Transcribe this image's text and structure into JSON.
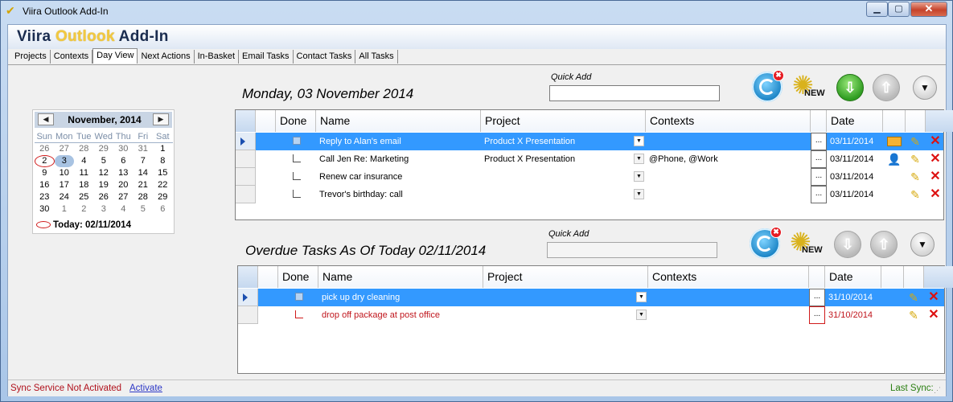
{
  "window": {
    "title": "Viira Outlook Add-In",
    "min_glyph": "▁",
    "max_glyph": "▢",
    "close_glyph": "✕"
  },
  "brand": {
    "part1": "Viira ",
    "part2": "Outlook",
    "part3": " Add-In"
  },
  "tabs": [
    {
      "label": "Projects",
      "active": false
    },
    {
      "label": "Contexts",
      "active": false
    },
    {
      "label": "Day View",
      "active": true
    },
    {
      "label": "Next Actions",
      "active": false
    },
    {
      "label": "In-Basket",
      "active": false
    },
    {
      "label": "Email Tasks",
      "active": false
    },
    {
      "label": "Contact Tasks",
      "active": false
    },
    {
      "label": "All Tasks",
      "active": false
    }
  ],
  "calendar": {
    "month_label": "November, 2014",
    "prev_glyph": "◀",
    "next_glyph": "▶",
    "weekdays": [
      "Sun",
      "Mon",
      "Tue",
      "Wed",
      "Thu",
      "Fri",
      "Sat"
    ],
    "weeks": [
      [
        "26",
        "27",
        "28",
        "29",
        "30",
        "31",
        "1"
      ],
      [
        "2",
        "3",
        "4",
        "5",
        "6",
        "7",
        "8"
      ],
      [
        "9",
        "10",
        "11",
        "12",
        "13",
        "14",
        "15"
      ],
      [
        "16",
        "17",
        "18",
        "19",
        "20",
        "21",
        "22"
      ],
      [
        "23",
        "24",
        "25",
        "26",
        "27",
        "28",
        "29"
      ],
      [
        "30",
        "1",
        "2",
        "3",
        "4",
        "5",
        "6"
      ]
    ],
    "today_label": "Today: 02/11/2014"
  },
  "day_section": {
    "title": "Monday, 03 November 2014",
    "quick_add_label": "Quick Add",
    "quick_add_value": "",
    "columns": [
      "Done",
      "Name",
      "Project",
      "Contexts",
      "Date"
    ],
    "rows": [
      {
        "name": "Reply to Alan's email",
        "project": "Product X Presentation",
        "contexts": "",
        "date": "03/11/2014",
        "selected": true,
        "icon": "mail-icon"
      },
      {
        "name": "Call Jen Re: Marketing",
        "project": "Product X Presentation",
        "contexts": "@Phone, @Work",
        "date": "03/11/2014",
        "selected": false,
        "icon": "contact-icon"
      },
      {
        "name": "Renew car insurance",
        "project": "",
        "contexts": "",
        "date": "03/11/2014",
        "selected": false,
        "icon": ""
      },
      {
        "name": "Trevor's birthday: call",
        "project": "",
        "contexts": "",
        "date": "03/11/2014",
        "selected": false,
        "icon": ""
      }
    ]
  },
  "overdue_section": {
    "title": "Overdue Tasks As Of Today 02/11/2014",
    "quick_add_label": "Quick Add",
    "quick_add_value": "",
    "columns": [
      "Done",
      "Name",
      "Project",
      "Contexts",
      "Date"
    ],
    "rows": [
      {
        "name": "pick up dry cleaning",
        "project": "",
        "contexts": "",
        "date": "31/10/2014",
        "selected": true
      },
      {
        "name": "drop off package at post office",
        "project": "",
        "contexts": "",
        "date": "31/10/2014",
        "selected": false
      }
    ]
  },
  "toolbar": {
    "new_label": "NEW",
    "down_glyph": "⇩",
    "up_glyph": "⇧",
    "dropdown_glyph": "▼",
    "badge_glyph": "✖"
  },
  "row_glyphs": {
    "ellipsis": "...",
    "combo": "▼",
    "edit": "✎",
    "delete": "✕",
    "contact": "👤"
  },
  "status": {
    "message": "Sync Service Not Activated",
    "activate_link": "Activate",
    "last_sync": "Last Sync:"
  },
  "colors": {
    "selection": "#3399ff",
    "overdue_red": "#c0161d",
    "brand_gold": "#f2c940"
  }
}
